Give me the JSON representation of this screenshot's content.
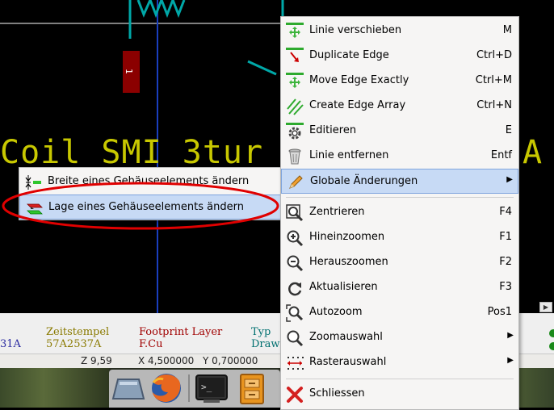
{
  "canvas": {
    "pad_label": "1",
    "footprint_text": "Coil SMI_3tur",
    "footprint_text_end": "A"
  },
  "context_menu": {
    "items": [
      {
        "label": "Linie verschieben",
        "shortcut": "M",
        "icon": "move-line-icon"
      },
      {
        "label": "Duplicate Edge",
        "shortcut": "Ctrl+D",
        "icon": "duplicate-edge-icon"
      },
      {
        "label": "Move Edge Exactly",
        "shortcut": "Ctrl+M",
        "icon": "move-exact-icon"
      },
      {
        "label": "Create Edge Array",
        "shortcut": "Ctrl+N",
        "icon": "edge-array-icon"
      },
      {
        "label": "Editieren",
        "shortcut": "E",
        "icon": "edit-gear-icon"
      },
      {
        "label": "Linie entfernen",
        "shortcut": "Entf",
        "icon": "trash-icon"
      },
      {
        "label": "Globale Änderungen",
        "shortcut": "",
        "icon": "pencil-icon",
        "submenu": true
      },
      {
        "label": "Zentrieren",
        "shortcut": "F4",
        "icon": "zoom-center-icon"
      },
      {
        "label": "Hineinzoomen",
        "shortcut": "F1",
        "icon": "zoom-in-icon"
      },
      {
        "label": "Herauszoomen",
        "shortcut": "F2",
        "icon": "zoom-out-icon"
      },
      {
        "label": "Aktualisieren",
        "shortcut": "F3",
        "icon": "refresh-icon"
      },
      {
        "label": "Autozoom",
        "shortcut": "Pos1",
        "icon": "autozoom-icon"
      },
      {
        "label": "Zoomauswahl",
        "shortcut": "",
        "icon": "zoom-select-icon",
        "submenu": true
      },
      {
        "label": "Rasterauswahl",
        "shortcut": "",
        "icon": "grid-select-icon",
        "submenu": true
      },
      {
        "label": "Schliessen",
        "shortcut": "",
        "icon": "close-x-icon"
      }
    ]
  },
  "submenu": {
    "items": [
      {
        "label": "Breite eines Gehäuseelements ändern",
        "icon": "width-change-icon"
      },
      {
        "label": "Lage eines Gehäuseelements ändern",
        "icon": "layer-change-icon"
      }
    ]
  },
  "message_panel": {
    "left_value": "31A",
    "zeitstempel_label": "Zeitstempel",
    "zeitstempel_value": "57A2537A",
    "footprint_layer_label": "Footprint Layer",
    "footprint_layer_value": "F.Cu",
    "typ_label": "Typ",
    "typ_value": "Draw"
  },
  "statusbar": {
    "zoom": "Z 9,59",
    "x": "X 4,500000",
    "y": "Y 0,700000"
  },
  "colors": {
    "highlight": "#c7daf5",
    "annotation_red": "#e00000",
    "footprint_yellow": "#c8c800",
    "cyan": "#00b0b0"
  }
}
